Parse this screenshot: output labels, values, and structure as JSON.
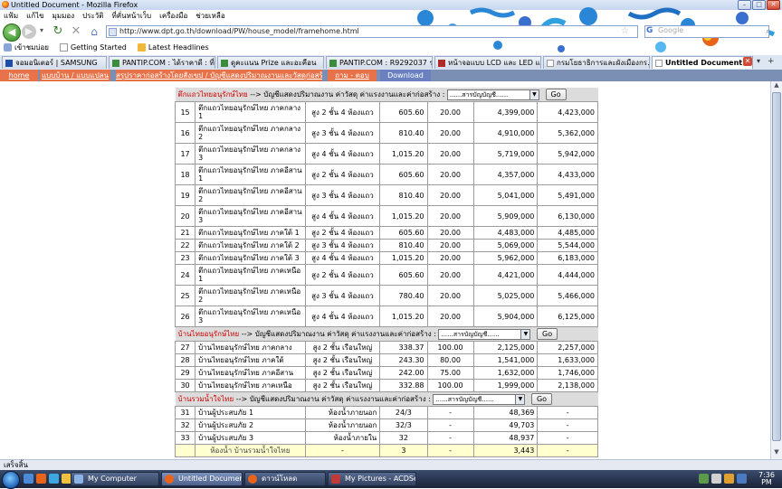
{
  "window": {
    "title": "Untitled Document - Mozilla Firefox"
  },
  "menubar": [
    "แฟ้ม",
    "แก้ไข",
    "มุมมอง",
    "ประวัติ",
    "ที่คั่นหน้าเว็บ",
    "เครื่องมือ",
    "ช่วยเหลือ"
  ],
  "navbar": {
    "url": "http://www.dpt.go.th/download/PW/house_model/framehome.html",
    "search_placeholder": "Google",
    "search_brand": "G"
  },
  "bookmarks": [
    "เข้าชมบ่อย",
    "Getting Started",
    "Latest Headlines"
  ],
  "tabs": [
    {
      "label": "จอมอนิเตอร์ | SAMSUNG"
    },
    {
      "label": "PANTIP.COM : ได้ราคาดี : ที่..."
    },
    {
      "label": "ดูคะแนน Prize และอะคือน"
    },
    {
      "label": "PANTIP.COM : R9292037 ระ..."
    },
    {
      "label": "หน้าจอแบบ LCD และ LED แล..."
    },
    {
      "label": "กรมโยธาธิการและผังเมืองกร..."
    },
    {
      "label": "Untitled Document"
    }
  ],
  "sitenav": [
    "home",
    "แบบบ้าน / แบบแปลน",
    "สรุปราคาก่อสร้างโดยสังเขป / บัญชีแสดงปริมาณงานและวัสดุก่อสร้าง",
    "ถาม - ตอบ",
    "Download"
  ],
  "section1": {
    "title": "ตึกแถวไทยอนุรักษ์ไทย",
    "arrow": "-->",
    "subtitle": "บัญชีแสดงปริมาณงาน ค่าวัสดุ ค่าแรงงานและค่าก่อสร้าง :",
    "select": "......สารบัญบัญชี......",
    "go": "Go",
    "rows": [
      {
        "no": "15",
        "name": [
          "ตึกแถวไทยอนุรักษ์ไทย ภาคกลาง",
          "1"
        ],
        "type": "สูง 2 ชั้น 4 ห้องแถว",
        "area": "605.60",
        "pct": "20.00",
        "cost": "4,399,000",
        "total": "4,423,000"
      },
      {
        "no": "16",
        "name": [
          "ตึกแถวไทยอนุรักษ์ไทย ภาคกลาง",
          "2"
        ],
        "type": "สูง 3 ชั้น 4 ห้องแถว",
        "area": "810.40",
        "pct": "20.00",
        "cost": "4,910,000",
        "total": "5,362,000"
      },
      {
        "no": "17",
        "name": [
          "ตึกแถวไทยอนุรักษ์ไทย ภาคกลาง",
          "3"
        ],
        "type": "สูง 4 ชั้น 4 ห้องแถว",
        "area": "1,015.20",
        "pct": "20.00",
        "cost": "5,719,000",
        "total": "5,942,000"
      },
      {
        "no": "18",
        "name": [
          "ตึกแถวไทยอนุรักษ์ไทย ภาคอีสาน",
          "1"
        ],
        "type": "สูง 2 ชั้น 4 ห้องแถว",
        "area": "605.60",
        "pct": "20.00",
        "cost": "4,357,000",
        "total": "4,433,000"
      },
      {
        "no": "19",
        "name": [
          "ตึกแถวไทยอนุรักษ์ไทย ภาคอีสาน",
          "2"
        ],
        "type": "สูง 3 ชั้น 4 ห้องแถว",
        "area": "810.40",
        "pct": "20.00",
        "cost": "5,041,000",
        "total": "5,491,000"
      },
      {
        "no": "20",
        "name": [
          "ตึกแถวไทยอนุรักษ์ไทย ภาคอีสาน",
          "3"
        ],
        "type": "สูง 4 ชั้น 4 ห้องแถว",
        "area": "1,015.20",
        "pct": "20.00",
        "cost": "5,909,000",
        "total": "6,130,000"
      },
      {
        "no": "21",
        "name": [
          "ตึกแถวไทยอนุรักษ์ไทย ภาคใต้ 1"
        ],
        "type": "สูง 2 ชั้น 4 ห้องแถว",
        "area": "605.60",
        "pct": "20.00",
        "cost": "4,483,000",
        "total": "4,485,000"
      },
      {
        "no": "22",
        "name": [
          "ตึกแถวไทยอนุรักษ์ไทย ภาคใต้ 2"
        ],
        "type": "สูง 3 ชั้น 4 ห้องแถว",
        "area": "810.40",
        "pct": "20.00",
        "cost": "5,069,000",
        "total": "5,544,000"
      },
      {
        "no": "23",
        "name": [
          "ตึกแถวไทยอนุรักษ์ไทย ภาคใต้ 3"
        ],
        "type": "สูง 4 ชั้น 4 ห้องแถว",
        "area": "1,015.20",
        "pct": "20.00",
        "cost": "5,962,000",
        "total": "6,183,000"
      },
      {
        "no": "24",
        "name": [
          "ตึกแถวไทยอนุรักษ์ไทย ภาคเหนือ",
          "1"
        ],
        "type": "สูง 2 ชั้น 4 ห้องแถว",
        "area": "605.60",
        "pct": "20.00",
        "cost": "4,421,000",
        "total": "4,444,000"
      },
      {
        "no": "25",
        "name": [
          "ตึกแถวไทยอนุรักษ์ไทย ภาคเหนือ",
          "2"
        ],
        "type": "สูง 3 ชั้น 4 ห้องแถว",
        "area": "780.40",
        "pct": "20.00",
        "cost": "5,025,000",
        "total": "5,466,000"
      },
      {
        "no": "26",
        "name": [
          "ตึกแถวไทยอนุรักษ์ไทย ภาคเหนือ",
          "3"
        ],
        "type": "สูง 4 ชั้น 4 ห้องแถว",
        "area": "1,015.20",
        "pct": "20.00",
        "cost": "5,904,000",
        "total": "6,125,000"
      }
    ]
  },
  "section2": {
    "title": "บ้านไทยอนุรักษ์ไทย",
    "arrow": "-->",
    "subtitle": "บัญชีแสดงปริมาณงาน ค่าวัสดุ ค่าแรงงานและค่าก่อสร้าง :",
    "select": "......สารบัญบัญชี......",
    "go": "Go",
    "rows": [
      {
        "no": "27",
        "name": "บ้านไทยอนุรักษ์ไทย ภาคกลาง",
        "type": "สูง 2 ชั้น เรือนใหญ่",
        "area": "338.37",
        "pct": "100.00",
        "cost": "2,125,000",
        "total": "2,257,000"
      },
      {
        "no": "28",
        "name": "บ้านไทยอนุรักษ์ไทย ภาคใต้",
        "type": "สูง 2 ชั้น เรือนใหญ่",
        "area": "243.30",
        "pct": "80.00",
        "cost": "1,541,000",
        "total": "1,633,000"
      },
      {
        "no": "29",
        "name": "บ้านไทยอนุรักษ์ไทย ภาคอีสาน",
        "type": "สูง 2 ชั้น เรือนใหญ่",
        "area": "242.00",
        "pct": "75.00",
        "cost": "1,632,000",
        "total": "1,746,000"
      },
      {
        "no": "30",
        "name": "บ้านไทยอนุรักษ์ไทย ภาคเหนือ",
        "type": "สูง 2 ชั้น เรือนใหญ่",
        "area": "332.88",
        "pct": "100.00",
        "cost": "1,999,000",
        "total": "2,138,000"
      }
    ]
  },
  "section3": {
    "title": "บ้านรวมน้ำใจไทย",
    "arrow": "-->",
    "subtitle": "บัญชีแสดงปริมาณงาน ค่าวัสดุ ค่าแรงงานและค่าก่อสร้าง :",
    "select": "......สารบัญบัญชี......",
    "go": "Go",
    "rows": [
      {
        "no": "31",
        "name": "บ้านผู้ประสบภัย 1",
        "type": "ห้องน้ำภายนอก",
        "area": "24/3",
        "pct": "-",
        "cost": "48,369",
        "total": "-"
      },
      {
        "no": "32",
        "name": "บ้านผู้ประสบภัย 2",
        "type": "ห้องน้ำภายนอก",
        "area": "32/3",
        "pct": "-",
        "cost": "49,703",
        "total": "-"
      },
      {
        "no": "33",
        "name": "บ้านผู้ประสบภัย 3",
        "type": "ห้องน้ำภายใน",
        "area": "32",
        "pct": "-",
        "cost": "48,937",
        "total": "-"
      }
    ],
    "total_row": {
      "name": "ห้องน้ำ บ้านรวมน้ำใจไทย",
      "type": "-",
      "area": "3",
      "pct": "-",
      "cost": "3,443",
      "total": "-"
    }
  },
  "statusbar": {
    "text": "เสร็จสิ้น"
  },
  "taskbar": {
    "items": [
      "My Computer",
      "Untitled Document - ...",
      "ดาวน์โหลด",
      "My Pictures - ACDSee..."
    ],
    "time": "7:36",
    "ampm": "PM"
  },
  "colors": {
    "nav_orange": "#e8734a",
    "nav_blue": "#6a80c0",
    "section_red": "#d00000",
    "total_yellow": "#ffffd0"
  }
}
